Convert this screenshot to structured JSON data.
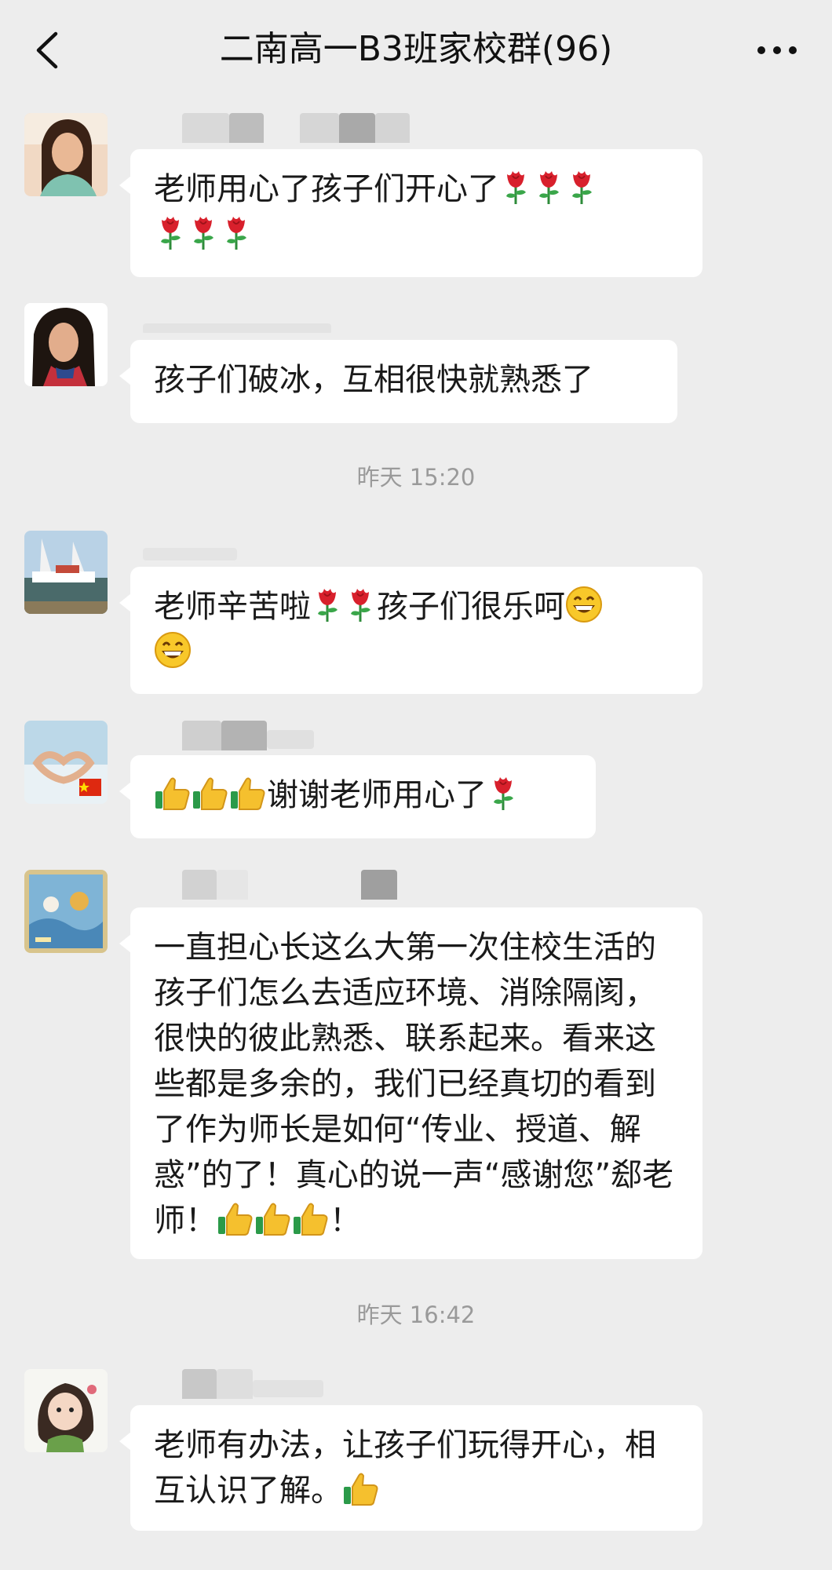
{
  "header": {
    "title": "二南高一B3班家校群(96)",
    "back_icon": "chevron-left-icon",
    "more_icon": "ellipsis-icon"
  },
  "messages": [
    {
      "text": "老师用心了孩子们开心了",
      "emoji": [
        "rose",
        "rose",
        "rose",
        "rose",
        "rose",
        "rose"
      ]
    },
    {
      "text": "孩子们破冰，互相很快就熟悉了",
      "emoji": []
    },
    {
      "text_a": "老师辛苦啦",
      "text_b": "孩子们很乐呵",
      "emoji": [
        "rose",
        "rose",
        "grin",
        "grin"
      ]
    },
    {
      "text": "谢谢老师用心了",
      "emoji": [
        "thumbs-up",
        "thumbs-up",
        "thumbs-up",
        "rose"
      ]
    },
    {
      "text": "一直担心长这么大第一次住校生活的孩子们怎么去适应环境、消除隔阂，很快的彼此熟悉、联系起来。看来这些都是多余的，我们已经真切的看到了作为师长是如何“传业、授道、解惑”的了！真心的说一声“感谢您”郄老师！",
      "end_punct": "！",
      "emoji": [
        "thumbs-up",
        "thumbs-up",
        "thumbs-up"
      ]
    },
    {
      "text": "老师有办法，让孩子们玩得开心，相互认识了解。",
      "emoji": [
        "thumbs-up"
      ]
    }
  ],
  "timestamps": [
    "昨天 15:20",
    "昨天 16:42"
  ],
  "colors": {
    "background": "#ededed",
    "bubble": "#ffffff",
    "timestamp": "#9a9a9a"
  }
}
